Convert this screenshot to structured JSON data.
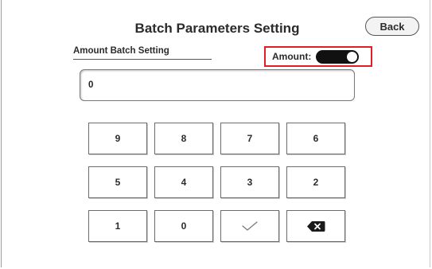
{
  "screen": {
    "title": "Batch Parameters Setting",
    "back_label": "Back"
  },
  "section": {
    "label": "Amount Batch Setting"
  },
  "amount_toggle": {
    "label": "Amount:",
    "state": "on",
    "highlight_color": "#e02020"
  },
  "input": {
    "value": "0"
  },
  "keypad": {
    "keys": [
      "9",
      "8",
      "7",
      "6",
      "5",
      "4",
      "3",
      "2",
      "1",
      "0"
    ],
    "confirm_icon": "checkmark-icon",
    "backspace_icon": "backspace-icon"
  }
}
